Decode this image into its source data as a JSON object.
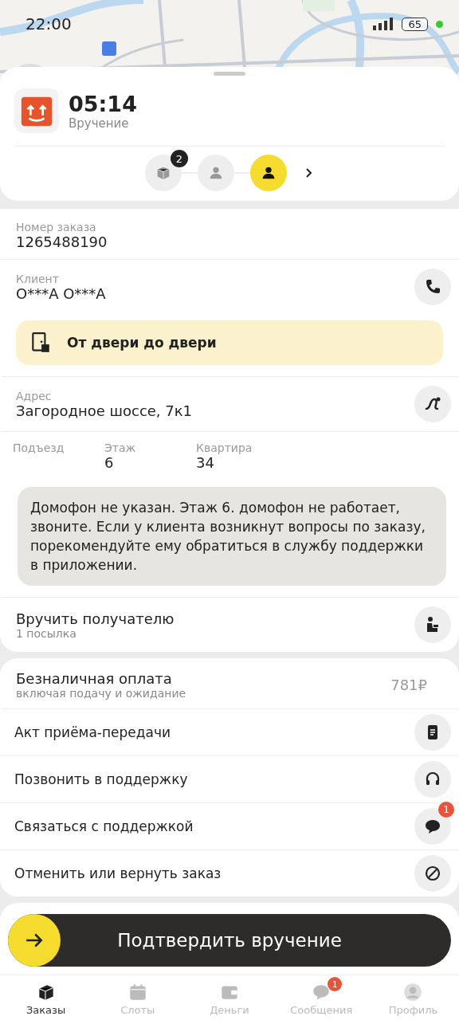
{
  "status_bar": {
    "time": "22:00",
    "battery": "65"
  },
  "header": {
    "timer": "05:14",
    "stage": "Вручение"
  },
  "steps": [
    {
      "kind": "package",
      "badge": "2",
      "selected": false
    },
    {
      "kind": "person",
      "selected": false
    },
    {
      "kind": "person",
      "selected": true
    }
  ],
  "order": {
    "label": "Номер заказа",
    "value": "1265488190"
  },
  "client": {
    "label": "Клиент",
    "value": "О***А О***А"
  },
  "delivery_type": "От двери до двери",
  "address": {
    "label": "Адрес",
    "value": "Загородное шоссе, 7к1"
  },
  "details": [
    {
      "label": "Подъезд"
    },
    {
      "label": "Этаж",
      "value": "6"
    },
    {
      "label": "Квартира",
      "value": "34"
    }
  ],
  "comment": "Домофон не указан. Этаж 6. домофон не работает, звоните. Если у клиента возникнут вопросы по заказу, порекомендуйте ему обратиться в службу поддержки в приложении.",
  "handover": {
    "title": "Вручить получателю",
    "subtitle": "1 посылка"
  },
  "payment": {
    "title": "Безналичная оплата",
    "subtitle": "включая подачу и ожидание",
    "amount": "781₽"
  },
  "actions": [
    {
      "kind": "document",
      "label": "Акт приёма-передачи"
    },
    {
      "kind": "headset",
      "label": "Позвонить в поддержку"
    },
    {
      "kind": "chat",
      "label": "Связаться с поддержкой",
      "badge": "1"
    },
    {
      "kind": "cancel",
      "label": "Отменить или вернуть заказ"
    }
  ],
  "confirm_button": "Подтвердить вручение",
  "tabs": [
    {
      "kind": "orders",
      "label": "Заказы",
      "selected": true
    },
    {
      "kind": "slots",
      "label": "Слоты",
      "selected": false
    },
    {
      "kind": "money",
      "label": "Деньги",
      "selected": false
    },
    {
      "kind": "messages",
      "label": "Сообщения",
      "selected": false,
      "badge": "1"
    },
    {
      "kind": "profile",
      "label": "Профиль",
      "selected": false
    }
  ]
}
